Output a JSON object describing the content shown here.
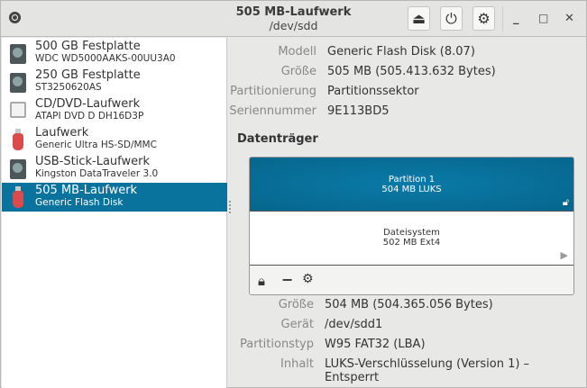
{
  "header": {
    "title": "505 MB-Laufwerk",
    "subtitle": "/dev/sdd"
  },
  "sidebar": {
    "items": [
      {
        "name": "500 GB Festplatte",
        "model": "WDC WD5000AAKS-00UU3A0",
        "icon": "hdd"
      },
      {
        "name": "250 GB Festplatte",
        "model": "ST3250620AS",
        "icon": "hdd"
      },
      {
        "name": "CD/DVD-Laufwerk",
        "model": "ATAPI   DVD D  DH16D3P",
        "icon": "cd"
      },
      {
        "name": "Laufwerk",
        "model": "Generic Ultra HS-SD/MMC",
        "icon": "usb"
      },
      {
        "name": "USB-Stick-Laufwerk",
        "model": "Kingston DataTraveler 3.0",
        "icon": "hdd"
      },
      {
        "name": "505 MB-Laufwerk",
        "model": "Generic Flash Disk",
        "icon": "usb"
      }
    ]
  },
  "drive": {
    "rows": [
      {
        "label": "Modell",
        "value": "Generic Flash Disk (8.07)"
      },
      {
        "label": "Größe",
        "value": "505 MB (505.413.632 Bytes)"
      },
      {
        "label": "Partitionierung",
        "value": "Partitionssektor"
      },
      {
        "label": "Seriennummer",
        "value": "9E113BD5"
      }
    ]
  },
  "volumes": {
    "heading": "Datenträger",
    "partition": {
      "name": "Partition 1",
      "desc": "504 MB LUKS"
    },
    "filesystem": {
      "name": "Dateisystem",
      "desc": "502 MB Ext4"
    }
  },
  "details": {
    "rows": [
      {
        "label": "Größe",
        "value": "504 MB (504.365.056 Bytes)"
      },
      {
        "label": "Gerät",
        "value": "/dev/sdd1"
      },
      {
        "label": "Partitionstyp",
        "value": "W95 FAT32 (LBA)"
      },
      {
        "label": "Inhalt",
        "value": "LUKS-Verschlüsselung (Version 1) – Entsperrt"
      }
    ]
  },
  "colors": {
    "accent": "#09739e"
  }
}
